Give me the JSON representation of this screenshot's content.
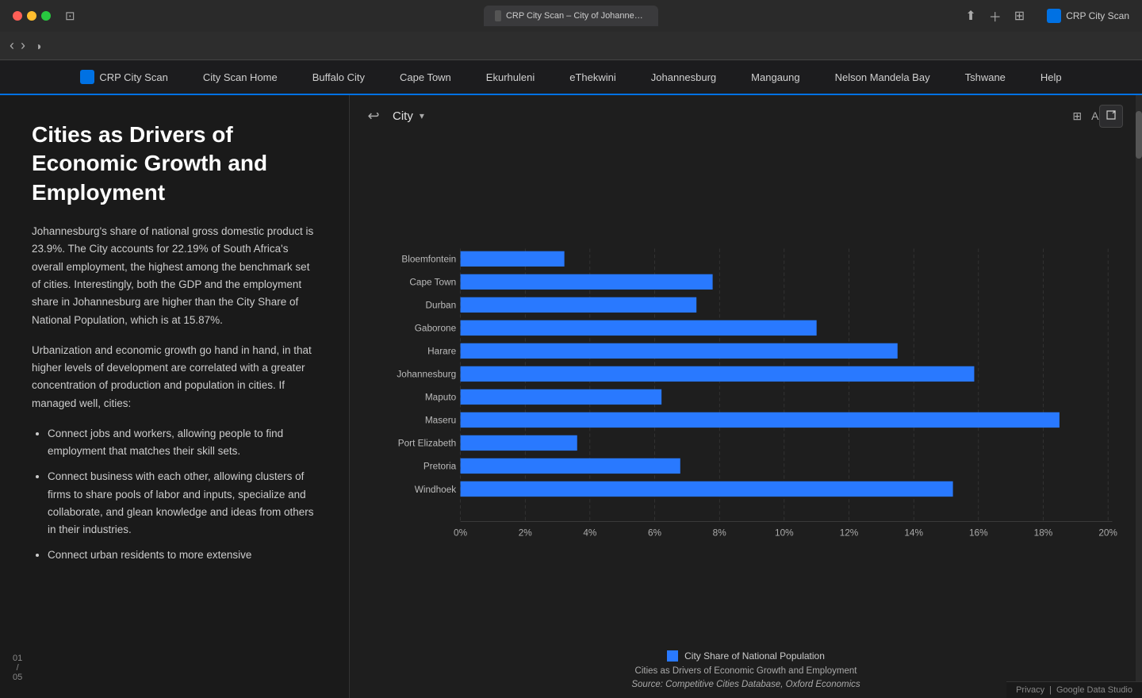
{
  "titlebar": {
    "tab_label": "CRP City Scan – City of Johannesburg Metropolitan Municipality",
    "crp_label": "CRP City Scan"
  },
  "navbar": {
    "back": "‹",
    "forward": "›"
  },
  "menu": {
    "logo_label": "CRP City Scan",
    "items": [
      "City Scan Home",
      "Buffalo City",
      "Cape Town",
      "Ekurhuleni",
      "eThekwini",
      "Johannesburg",
      "Mangaung",
      "Nelson Mandela Bay",
      "Tshwane",
      "Help"
    ]
  },
  "left_panel": {
    "heading": "Cities as Drivers of Economic Growth and Employment",
    "paragraph1": "Johannesburg's share of national gross domestic product is 23.9%. The City accounts for 22.19% of South Africa's overall employment, the highest among the benchmark set of cities. Interestingly, both the GDP and the employment share in Johannesburg are higher than the City Share of National Population, which is at 15.87%.",
    "paragraph2": "Urbanization and economic growth go hand in hand, in that higher levels of development are correlated with a greater concentration of production and population in cities. If managed well, cities:",
    "bullets": [
      "Connect jobs and workers, allowing people to find employment that matches their skill sets.",
      "Connect business with each other, allowing clusters of firms to share pools of labor and inputs, specialize and collaborate, and glean knowledge and ideas from others in their industries.",
      "Connect urban residents to more extensive"
    ],
    "page_current": "01",
    "page_separator": "/",
    "page_total": "05"
  },
  "chart": {
    "dropdown_label": "City",
    "back_symbol": "↩",
    "bars": [
      {
        "label": "Bloemfontein",
        "value": 3.2,
        "pct": 3.2
      },
      {
        "label": "Cape Town",
        "value": 7.8,
        "pct": 7.8
      },
      {
        "label": "Durban",
        "value": 7.3,
        "pct": 7.3
      },
      {
        "label": "Gaborone",
        "value": 11.0,
        "pct": 11.0
      },
      {
        "label": "Harare",
        "value": 13.5,
        "pct": 13.5
      },
      {
        "label": "Johannesburg",
        "value": 15.87,
        "pct": 15.87
      },
      {
        "label": "Maputo",
        "value": 6.2,
        "pct": 6.2
      },
      {
        "label": "Maseru",
        "value": 18.5,
        "pct": 18.5
      },
      {
        "label": "Port Elizabeth",
        "value": 3.6,
        "pct": 3.6
      },
      {
        "label": "Pretoria",
        "value": 6.8,
        "pct": 6.8
      },
      {
        "label": "Windhoek",
        "value": 15.2,
        "pct": 15.2
      }
    ],
    "x_axis_labels": [
      "0%",
      "2%",
      "4%",
      "6%",
      "8%",
      "10%",
      "12%",
      "14%",
      "16%",
      "18%",
      "20%"
    ],
    "x_max": 20,
    "legend_label": "City Share of National Population",
    "bar_color": "#2979ff",
    "caption_line1": "Cities as Drivers of Economic Growth and Employment",
    "caption_line2": "Source: Competitive Cities Database, Oxford Economics"
  },
  "bottom_bar": {
    "privacy": "Privacy",
    "separator": "|",
    "powered_by": "Google Data Studio"
  }
}
